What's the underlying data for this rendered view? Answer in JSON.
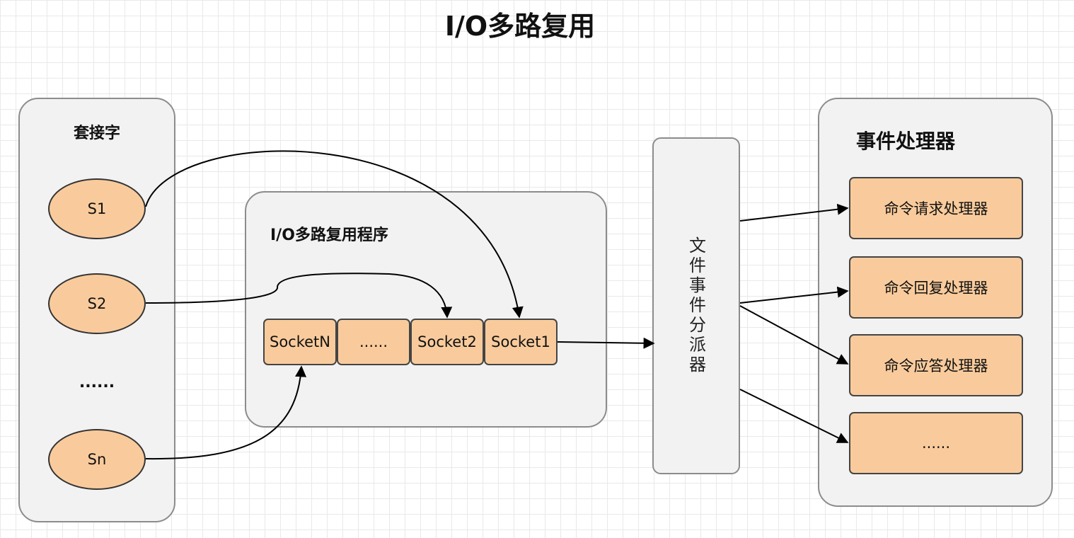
{
  "title": "I/O多路复用",
  "sockets_panel": {
    "title": "套接字",
    "items": [
      "S1",
      "S2",
      "Sn"
    ],
    "ellipsis": "......"
  },
  "multiplexer": {
    "title": "I/O多路复用程序",
    "queue": [
      "SocketN",
      "......",
      "Socket2",
      "Socket1"
    ]
  },
  "dispatcher": {
    "label": "文件事件分派器"
  },
  "handlers": {
    "title": "事件处理器",
    "items": [
      "命令请求处理器",
      "命令回复处理器",
      "命令应答处理器",
      "......"
    ]
  },
  "colors": {
    "node_fill": "#f9cb9c",
    "panel_fill": "#f2f2f3",
    "panel_border": "#8c8c8c",
    "edge": "#000000"
  }
}
